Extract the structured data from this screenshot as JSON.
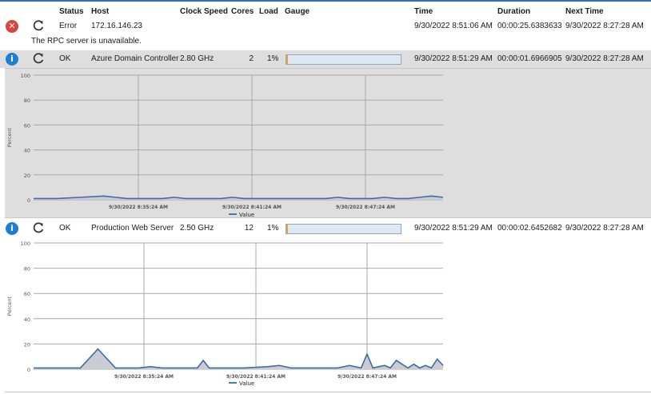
{
  "columns": {
    "status": "Status",
    "host": "Host",
    "clock_speed": "Clock Speed",
    "cores": "Cores",
    "load": "Load",
    "gauge": "Gauge",
    "time": "Time",
    "duration": "Duration",
    "next_time": "Next Time"
  },
  "rows": [
    {
      "state_icon": "error-icon",
      "status": "Error",
      "host": "172.16.146.23",
      "clock_speed": "",
      "cores": "",
      "load": "",
      "time": "9/30/2022 8:51:06 AM",
      "duration": "00:00:25.6383633",
      "next_time": "9/30/2022 8:27:28 AM",
      "message": "The RPC server is unavailable."
    },
    {
      "state_icon": "info-icon",
      "status": "OK",
      "host": "Azure Domain Controller",
      "clock_speed": "2.80 GHz",
      "cores": "2",
      "load": "1%",
      "gauge_fraction": 0.01,
      "time": "9/30/2022 8:51:29 AM",
      "duration": "00:00:01.6966905",
      "next_time": "9/30/2022 8:27:28 AM"
    },
    {
      "state_icon": "info-icon",
      "status": "OK",
      "host": "Production Web Server",
      "clock_speed": "2.50 GHz",
      "cores": "12",
      "load": "1%",
      "gauge_fraction": 0.01,
      "time": "9/30/2022 8:51:29 AM",
      "duration": "00:00:02.6452682",
      "next_time": "9/30/2022 8:27:28 AM"
    }
  ],
  "colors": {
    "error": "#d9443d",
    "info": "#1e7fd0",
    "series": "#3f6aa6",
    "gauge_fill": "#e8a33d",
    "gauge_bg": "#dde8f3"
  },
  "chart_data": [
    {
      "type": "area",
      "ylabel": "Percent",
      "ylim": [
        0,
        100
      ],
      "yticks": [
        0,
        20,
        40,
        60,
        80,
        100
      ],
      "x_tick_labels": [
        "9/30/2022 8:35:24 AM",
        "9/30/2022 8:41:24 AM",
        "9/30/2022 8:47:24 AM"
      ],
      "x_range_minutes": [
        8.5,
        8.85
      ],
      "legend": "Value",
      "grid": true,
      "series": [
        {
          "name": "Value",
          "x_minutes": [
            8.5,
            8.52,
            8.54,
            8.56,
            8.57,
            8.58,
            8.59,
            8.6,
            8.61,
            8.62,
            8.63,
            8.64,
            8.65,
            8.66,
            8.67,
            8.68,
            8.69,
            8.7,
            8.71,
            8.72,
            8.73,
            8.74,
            8.75,
            8.76,
            8.77,
            8.78,
            8.79,
            8.8,
            8.81,
            8.82,
            8.83,
            8.84,
            8.85
          ],
          "values": [
            1,
            1,
            2,
            3,
            2,
            1,
            1,
            1,
            1,
            2,
            1,
            1,
            1,
            1,
            2,
            1,
            1,
            1,
            1,
            1,
            1,
            1,
            1,
            2,
            1,
            1,
            1,
            2,
            1,
            1,
            2,
            3,
            2
          ]
        }
      ]
    },
    {
      "type": "area",
      "ylabel": "Percent",
      "ylim": [
        0,
        100
      ],
      "yticks": [
        0,
        20,
        40,
        60,
        80,
        100
      ],
      "x_tick_labels": [
        "9/30/2022 8:35:24 AM",
        "9/30/2022 8:41:24 AM",
        "9/30/2022 8:47:24 AM"
      ],
      "x_range_minutes": [
        8.5,
        8.85
      ],
      "legend": "Value",
      "grid": true,
      "series": [
        {
          "name": "Value",
          "x_minutes": [
            8.5,
            8.52,
            8.54,
            8.555,
            8.57,
            8.59,
            8.6,
            8.61,
            8.62,
            8.63,
            8.64,
            8.645,
            8.65,
            8.66,
            8.68,
            8.7,
            8.71,
            8.72,
            8.73,
            8.74,
            8.75,
            8.76,
            8.77,
            8.78,
            8.785,
            8.79,
            8.8,
            8.805,
            8.81,
            8.82,
            8.825,
            8.83,
            8.835,
            8.84,
            8.845,
            8.85
          ],
          "values": [
            1,
            1,
            1,
            16,
            1,
            1,
            2,
            1,
            1,
            1,
            1,
            7,
            1,
            1,
            1,
            2,
            3,
            1,
            1,
            1,
            1,
            1,
            3,
            1,
            12,
            1,
            3,
            1,
            7,
            1,
            4,
            1,
            3,
            1,
            8,
            3
          ]
        }
      ]
    }
  ]
}
